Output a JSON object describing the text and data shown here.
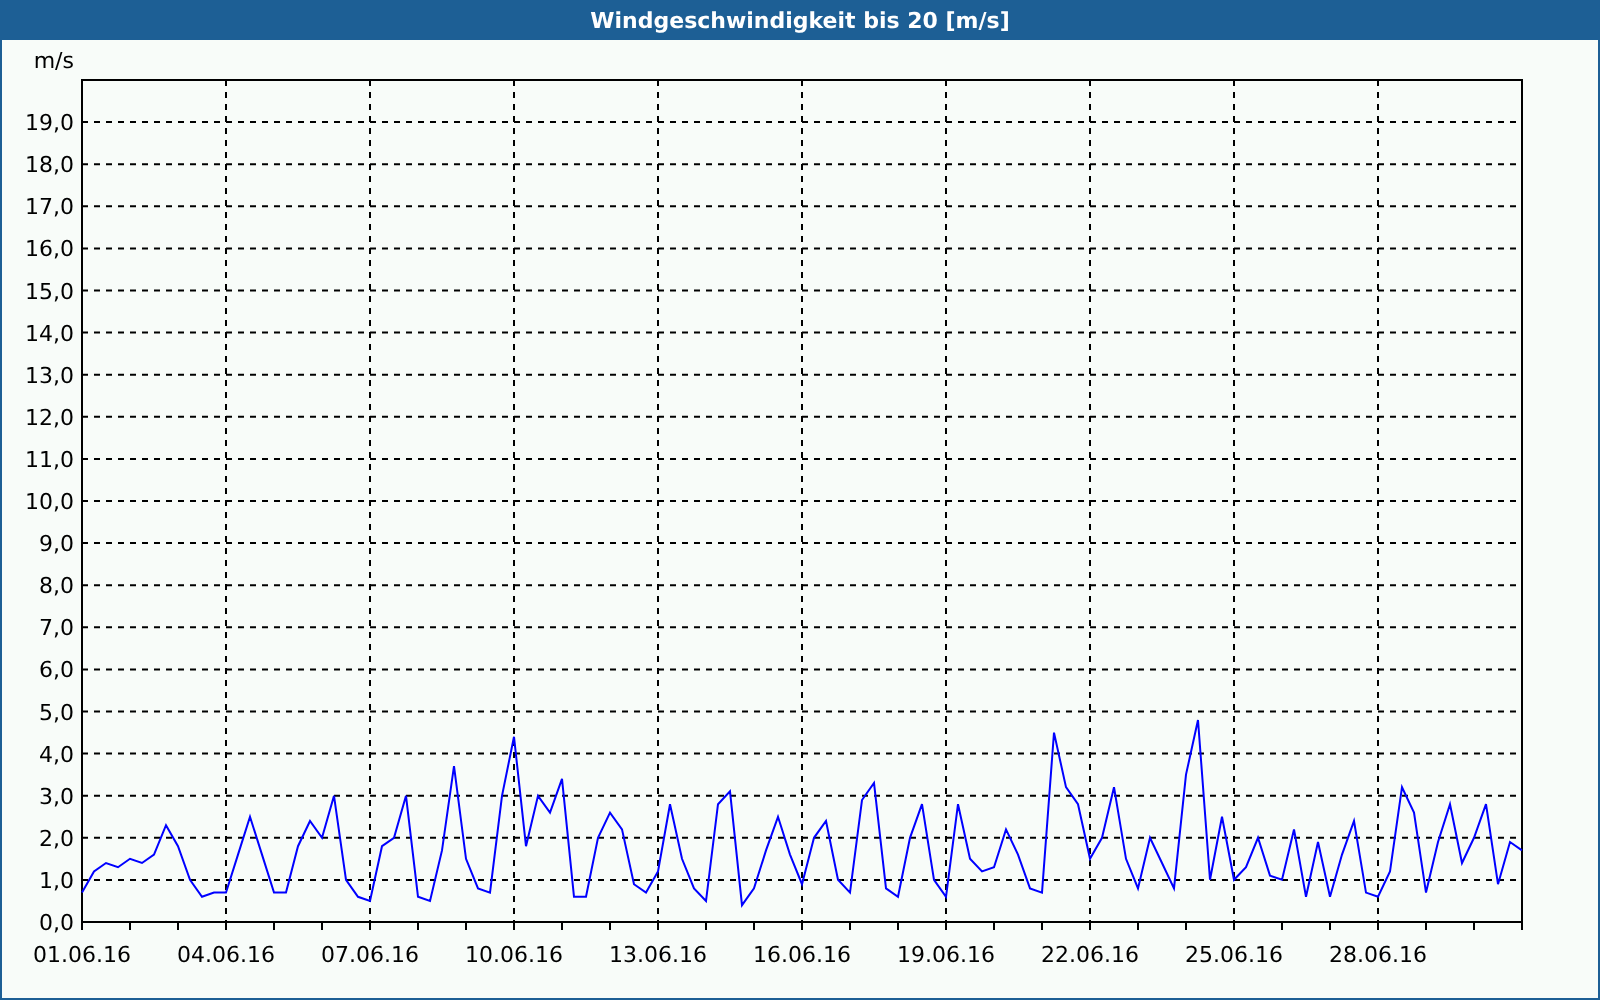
{
  "window": {
    "title": "Windgeschwindigkeit bis 20 [m/s]"
  },
  "chart": {
    "chart_data": {
      "type": "line",
      "ylabel": "m/s",
      "grid": true,
      "ylim": [
        0,
        20
      ],
      "yticks": [
        {
          "value": 0,
          "label": "0,0"
        },
        {
          "value": 1,
          "label": "1,0"
        },
        {
          "value": 2,
          "label": "2,0"
        },
        {
          "value": 3,
          "label": "3,0"
        },
        {
          "value": 4,
          "label": "4,0"
        },
        {
          "value": 5,
          "label": "5,0"
        },
        {
          "value": 6,
          "label": "6,0"
        },
        {
          "value": 7,
          "label": "7,0"
        },
        {
          "value": 8,
          "label": "8,0"
        },
        {
          "value": 9,
          "label": "9,0"
        },
        {
          "value": 10,
          "label": "10,0"
        },
        {
          "value": 11,
          "label": "11,0"
        },
        {
          "value": 12,
          "label": "12,0"
        },
        {
          "value": 13,
          "label": "13,0"
        },
        {
          "value": 14,
          "label": "14,0"
        },
        {
          "value": 15,
          "label": "15,0"
        },
        {
          "value": 16,
          "label": "16,0"
        },
        {
          "value": 17,
          "label": "17,0"
        },
        {
          "value": 18,
          "label": "18,0"
        },
        {
          "value": 19,
          "label": "19,0"
        }
      ],
      "categories": [
        "01.06.16",
        null,
        null,
        null,
        null,
        null,
        null,
        null,
        null,
        null,
        null,
        null,
        "04.06.16",
        null,
        null,
        null,
        null,
        null,
        null,
        null,
        null,
        null,
        null,
        null,
        "07.06.16",
        null,
        null,
        null,
        null,
        null,
        null,
        null,
        null,
        null,
        null,
        null,
        "10.06.16",
        null,
        null,
        null,
        null,
        null,
        null,
        null,
        null,
        null,
        null,
        null,
        "13.06.16",
        null,
        null,
        null,
        null,
        null,
        null,
        null,
        null,
        null,
        null,
        null,
        "16.06.16",
        null,
        null,
        null,
        null,
        null,
        null,
        null,
        null,
        null,
        null,
        null,
        "19.06.16",
        null,
        null,
        null,
        null,
        null,
        null,
        null,
        null,
        null,
        null,
        null,
        "22.06.16",
        null,
        null,
        null,
        null,
        null,
        null,
        null,
        null,
        null,
        null,
        null,
        "25.06.16",
        null,
        null,
        null,
        null,
        null,
        null,
        null,
        null,
        null,
        null,
        null,
        "28.06.16",
        null,
        null,
        null,
        null,
        null,
        null,
        null,
        null,
        null,
        null,
        null,
        null
      ],
      "series": [
        {
          "color": "#0000ff",
          "values": [
            0.7,
            1.2,
            1.4,
            1.3,
            1.5,
            1.4,
            1.6,
            2.3,
            1.8,
            1.0,
            0.6,
            0.7,
            0.7,
            1.6,
            2.5,
            1.6,
            0.7,
            0.7,
            1.8,
            2.4,
            2.0,
            3.0,
            1.0,
            0.6,
            0.5,
            1.8,
            2.0,
            3.0,
            0.6,
            0.5,
            1.7,
            3.7,
            1.5,
            0.8,
            0.7,
            3.0,
            4.4,
            1.8,
            3.0,
            2.6,
            3.4,
            0.6,
            0.6,
            2.0,
            2.6,
            2.2,
            0.9,
            0.7,
            1.2,
            2.8,
            1.5,
            0.8,
            0.5,
            2.8,
            3.1,
            0.4,
            0.8,
            1.7,
            2.5,
            1.6,
            0.9,
            2.0,
            2.4,
            1.0,
            0.7,
            2.9,
            3.3,
            0.8,
            0.6,
            2.0,
            2.8,
            1.0,
            0.6,
            2.8,
            1.5,
            1.2,
            1.3,
            2.2,
            1.6,
            0.8,
            0.7,
            4.5,
            3.2,
            2.8,
            1.5,
            2.0,
            3.2,
            1.5,
            0.8,
            2.0,
            1.4,
            0.8,
            3.5,
            4.8,
            1.0,
            2.5,
            1.0,
            1.3,
            2.0,
            1.1,
            1.0,
            2.2,
            0.6,
            1.9,
            0.6,
            1.6,
            2.4,
            0.7,
            0.6,
            1.2,
            3.2,
            2.6,
            0.7,
            1.9,
            2.8,
            1.4,
            2.0,
            2.8,
            0.9,
            1.9,
            1.7
          ]
        }
      ]
    }
  }
}
